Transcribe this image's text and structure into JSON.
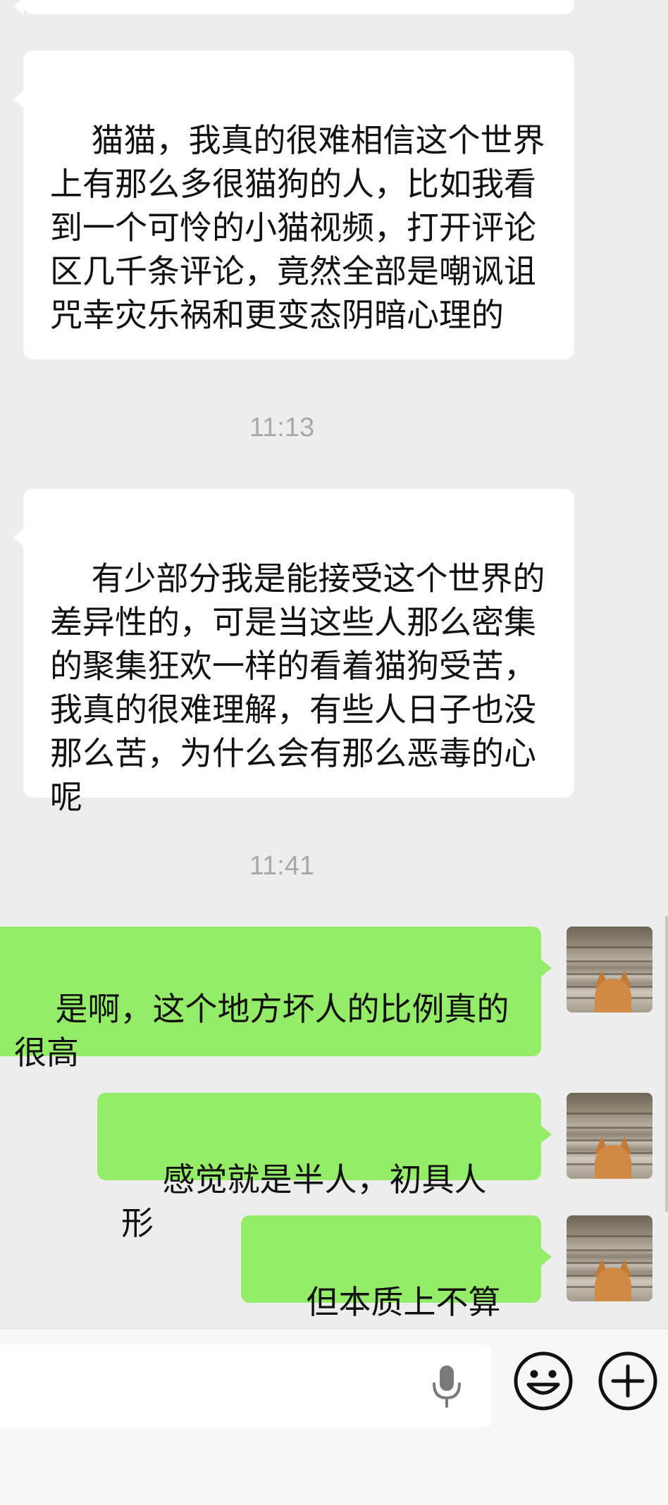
{
  "messages": [
    {
      "direction": "incoming",
      "text": "猫猫，我真的很难相信这个世界上有那么多很猫狗的人，比如我看到一个可怜的小猫视频，打开评论区几千条评论，竟然全部是嘲讽诅咒幸灾乐祸和更变态阴暗心理的"
    },
    {
      "direction": "incoming",
      "text": "有少部分我是能接受这个世界的差异性的，可是当这些人那么密集的聚集狂欢一样的看着猫狗受苦，我真的很难理解，有些人日子也没那么苦，为什么会有那么恶毒的心呢"
    },
    {
      "direction": "outgoing",
      "text": "是啊，这个地方坏人的比例真的很高"
    },
    {
      "direction": "outgoing",
      "text": "感觉就是半人，初具人形"
    },
    {
      "direction": "outgoing",
      "text": "但本质上不算人"
    }
  ],
  "timestamps": [
    "11:13",
    "11:41"
  ],
  "colors": {
    "background": "#ededed",
    "incoming_bubble": "#ffffff",
    "outgoing_bubble": "#95ec69",
    "timestamp_text": "#a8a8a8"
  },
  "input_bar": {
    "icons": [
      "microphone-icon",
      "emoji-icon",
      "plus-icon"
    ]
  }
}
